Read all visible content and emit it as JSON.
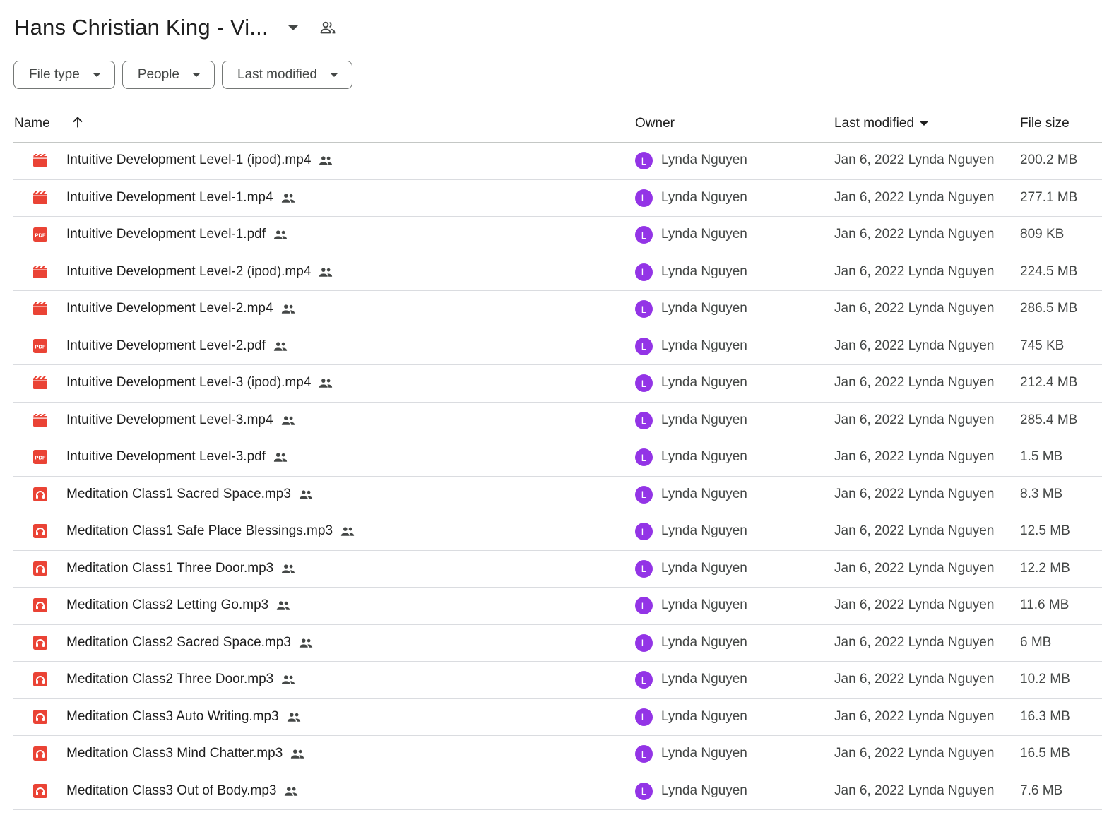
{
  "header": {
    "title": "Hans Christian King - Vi...",
    "title_menu_icon": "caret-down-icon",
    "shared_icon": "shared-folder-icon"
  },
  "filters": [
    {
      "label": "File type"
    },
    {
      "label": "People"
    },
    {
      "label": "Last modified"
    }
  ],
  "columns": {
    "name": "Name",
    "owner": "Owner",
    "last_modified": "Last modified",
    "file_size": "File size",
    "sort_icon": "arrow-up-icon"
  },
  "colors": {
    "file_icon": "#ea4335",
    "avatar": "#9334e6",
    "divider": "#dadce0"
  },
  "rows": [
    {
      "type": "video",
      "name": "Intuitive Development Level-1 (ipod).mp4",
      "avatar": "L",
      "owner": "Lynda Nguyen",
      "modified": "Jan 6, 2022 Lynda Nguyen",
      "size": "200.2 MB"
    },
    {
      "type": "video",
      "name": "Intuitive Development Level-1.mp4",
      "avatar": "L",
      "owner": "Lynda Nguyen",
      "modified": "Jan 6, 2022 Lynda Nguyen",
      "size": "277.1 MB"
    },
    {
      "type": "pdf",
      "name": "Intuitive Development Level-1.pdf",
      "avatar": "L",
      "owner": "Lynda Nguyen",
      "modified": "Jan 6, 2022 Lynda Nguyen",
      "size": "809 KB"
    },
    {
      "type": "video",
      "name": "Intuitive Development Level-2 (ipod).mp4",
      "avatar": "L",
      "owner": "Lynda Nguyen",
      "modified": "Jan 6, 2022 Lynda Nguyen",
      "size": "224.5 MB"
    },
    {
      "type": "video",
      "name": "Intuitive Development Level-2.mp4",
      "avatar": "L",
      "owner": "Lynda Nguyen",
      "modified": "Jan 6, 2022 Lynda Nguyen",
      "size": "286.5 MB"
    },
    {
      "type": "pdf",
      "name": "Intuitive Development Level-2.pdf",
      "avatar": "L",
      "owner": "Lynda Nguyen",
      "modified": "Jan 6, 2022 Lynda Nguyen",
      "size": "745 KB"
    },
    {
      "type": "video",
      "name": "Intuitive Development Level-3 (ipod).mp4",
      "avatar": "L",
      "owner": "Lynda Nguyen",
      "modified": "Jan 6, 2022 Lynda Nguyen",
      "size": "212.4 MB"
    },
    {
      "type": "video",
      "name": "Intuitive Development Level-3.mp4",
      "avatar": "L",
      "owner": "Lynda Nguyen",
      "modified": "Jan 6, 2022 Lynda Nguyen",
      "size": "285.4 MB"
    },
    {
      "type": "pdf",
      "name": "Intuitive Development Level-3.pdf",
      "avatar": "L",
      "owner": "Lynda Nguyen",
      "modified": "Jan 6, 2022 Lynda Nguyen",
      "size": "1.5 MB"
    },
    {
      "type": "audio",
      "name": "Meditation Class1 Sacred Space.mp3",
      "avatar": "L",
      "owner": "Lynda Nguyen",
      "modified": "Jan 6, 2022 Lynda Nguyen",
      "size": "8.3 MB"
    },
    {
      "type": "audio",
      "name": "Meditation Class1 Safe Place Blessings.mp3",
      "avatar": "L",
      "owner": "Lynda Nguyen",
      "modified": "Jan 6, 2022 Lynda Nguyen",
      "size": "12.5 MB"
    },
    {
      "type": "audio",
      "name": "Meditation Class1 Three Door.mp3",
      "avatar": "L",
      "owner": "Lynda Nguyen",
      "modified": "Jan 6, 2022 Lynda Nguyen",
      "size": "12.2 MB"
    },
    {
      "type": "audio",
      "name": "Meditation Class2 Letting Go.mp3",
      "avatar": "L",
      "owner": "Lynda Nguyen",
      "modified": "Jan 6, 2022 Lynda Nguyen",
      "size": "11.6 MB"
    },
    {
      "type": "audio",
      "name": "Meditation Class2 Sacred Space.mp3",
      "avatar": "L",
      "owner": "Lynda Nguyen",
      "modified": "Jan 6, 2022 Lynda Nguyen",
      "size": "6 MB"
    },
    {
      "type": "audio",
      "name": "Meditation Class2 Three Door.mp3",
      "avatar": "L",
      "owner": "Lynda Nguyen",
      "modified": "Jan 6, 2022 Lynda Nguyen",
      "size": "10.2 MB"
    },
    {
      "type": "audio",
      "name": "Meditation Class3 Auto Writing.mp3",
      "avatar": "L",
      "owner": "Lynda Nguyen",
      "modified": "Jan 6, 2022 Lynda Nguyen",
      "size": "16.3 MB"
    },
    {
      "type": "audio",
      "name": "Meditation Class3 Mind Chatter.mp3",
      "avatar": "L",
      "owner": "Lynda Nguyen",
      "modified": "Jan 6, 2022 Lynda Nguyen",
      "size": "16.5 MB"
    },
    {
      "type": "audio",
      "name": "Meditation Class3 Out of Body.mp3",
      "avatar": "L",
      "owner": "Lynda Nguyen",
      "modified": "Jan 6, 2022 Lynda Nguyen",
      "size": "7.6 MB"
    }
  ]
}
